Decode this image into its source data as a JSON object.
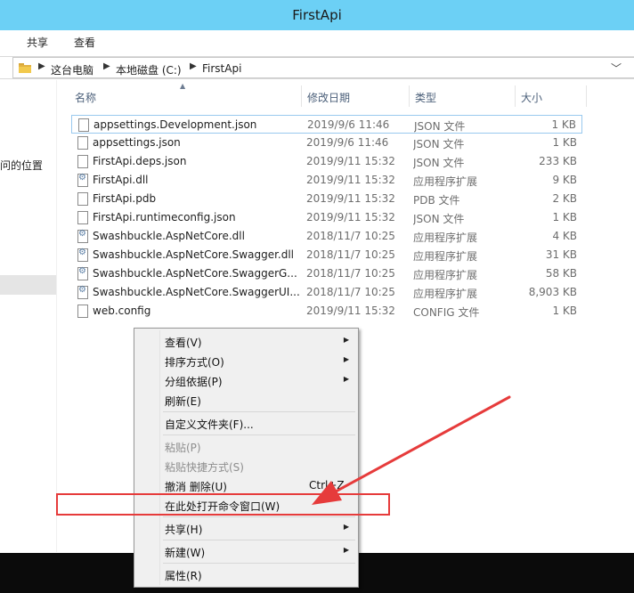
{
  "window": {
    "title": "FirstApi"
  },
  "ribbon": {
    "tabs": [
      "共享",
      "查看"
    ]
  },
  "address": {
    "crumbs": [
      "这台电脑",
      "本地磁盘 (C:)",
      "FirstApi"
    ]
  },
  "nav": {
    "partial_label": "问的位置"
  },
  "columns": {
    "name": "名称",
    "modified": "修改日期",
    "type": "类型",
    "size": "大小"
  },
  "files": [
    {
      "name": "appsettings.Development.json",
      "modified": "2019/9/6 11:46",
      "type": "JSON 文件",
      "size": "1 KB",
      "icon": "file-icon"
    },
    {
      "name": "appsettings.json",
      "modified": "2019/9/6 11:46",
      "type": "JSON 文件",
      "size": "1 KB",
      "icon": "file-icon"
    },
    {
      "name": "FirstApi.deps.json",
      "modified": "2019/9/11 15:32",
      "type": "JSON 文件",
      "size": "233 KB",
      "icon": "file-icon"
    },
    {
      "name": "FirstApi.dll",
      "modified": "2019/9/11 15:32",
      "type": "应用程序扩展",
      "size": "9 KB",
      "icon": "dll-icon"
    },
    {
      "name": "FirstApi.pdb",
      "modified": "2019/9/11 15:32",
      "type": "PDB 文件",
      "size": "2 KB",
      "icon": "file-icon"
    },
    {
      "name": "FirstApi.runtimeconfig.json",
      "modified": "2019/9/11 15:32",
      "type": "JSON 文件",
      "size": "1 KB",
      "icon": "file-icon"
    },
    {
      "name": "Swashbuckle.AspNetCore.dll",
      "modified": "2018/11/7 10:25",
      "type": "应用程序扩展",
      "size": "4 KB",
      "icon": "dll-icon"
    },
    {
      "name": "Swashbuckle.AspNetCore.Swagger.dll",
      "modified": "2018/11/7 10:25",
      "type": "应用程序扩展",
      "size": "31 KB",
      "icon": "dll-icon"
    },
    {
      "name": "Swashbuckle.AspNetCore.SwaggerG...",
      "modified": "2018/11/7 10:25",
      "type": "应用程序扩展",
      "size": "58 KB",
      "icon": "dll-icon"
    },
    {
      "name": "Swashbuckle.AspNetCore.SwaggerUI...",
      "modified": "2018/11/7 10:25",
      "type": "应用程序扩展",
      "size": "8,903 KB",
      "icon": "dll-icon"
    },
    {
      "name": "web.config",
      "modified": "2019/9/11 15:32",
      "type": "CONFIG 文件",
      "size": "1 KB",
      "icon": "file-icon"
    }
  ],
  "context_menu": {
    "view": "查看(V)",
    "sort": "排序方式(O)",
    "group": "分组依据(P)",
    "refresh": "刷新(E)",
    "customize": "自定义文件夹(F)...",
    "paste": "粘贴(P)",
    "paste_shortcut": "粘贴快捷方式(S)",
    "undo": "撤消 删除(U)",
    "undo_shortcut": "Ctrl+Z",
    "open_cmd": "在此处打开命令窗口(W)",
    "share": "共享(H)",
    "new": "新建(W)",
    "properties": "属性(R)"
  },
  "colors": {
    "titlebar": "#6cd0f5",
    "annotation": "#e63b3b",
    "taskbar": "#0b0b0b"
  }
}
